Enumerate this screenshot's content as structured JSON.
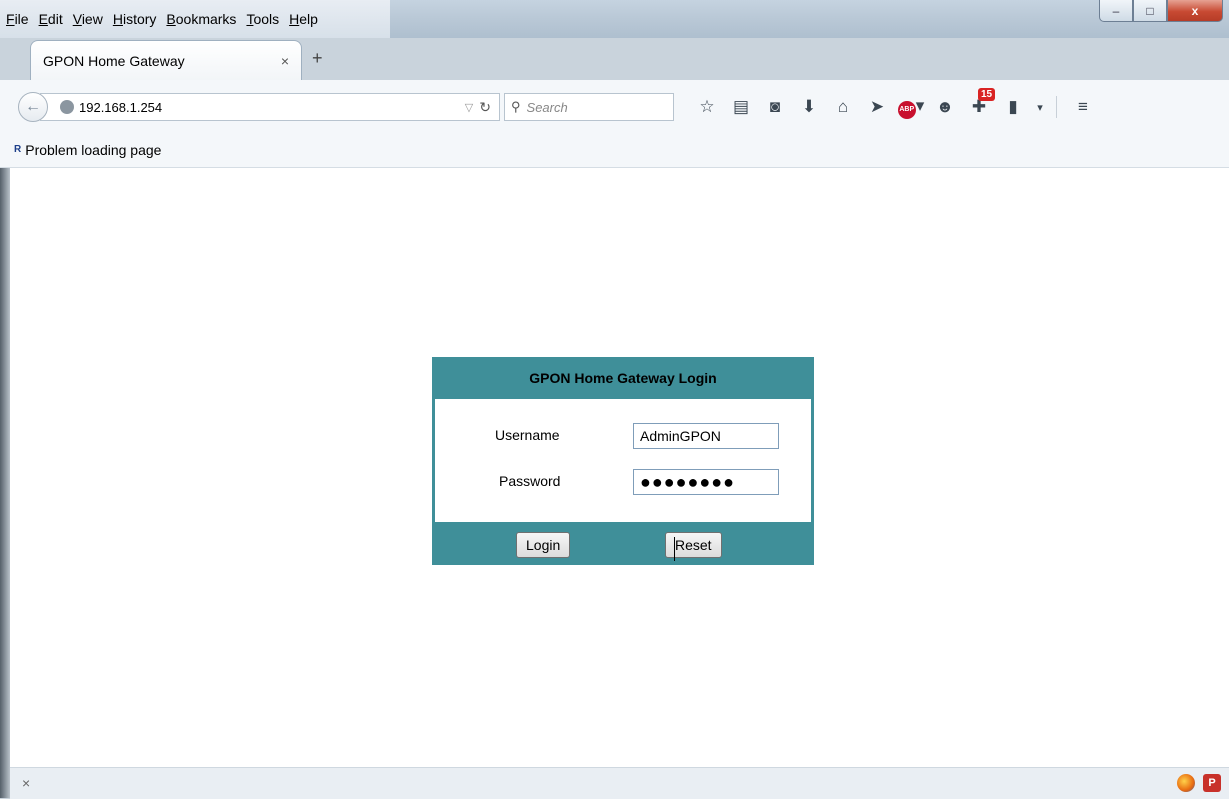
{
  "menu": {
    "items": [
      "File",
      "Edit",
      "View",
      "History",
      "Bookmarks",
      "Tools",
      "Help"
    ]
  },
  "window_buttons": {
    "minimize": "–",
    "maximize": "□",
    "close": "x"
  },
  "tab": {
    "title": "GPON Home Gateway",
    "close": "×",
    "new_tab": "+"
  },
  "navbar": {
    "url": "192.168.1.254",
    "search_placeholder": "Search",
    "downloads_badge": "15"
  },
  "bookmarks_bar": {
    "icon_text": "R",
    "label": "Problem loading page"
  },
  "login": {
    "title": "GPON Home Gateway Login",
    "username_label": "Username",
    "username_value": "AdminGPON",
    "password_label": "Password",
    "password_value": "●●●●●●●●",
    "login_button": "Login",
    "reset_button": "Reset"
  },
  "statusbar": {
    "close": "×",
    "p_icon": "P"
  },
  "colors": {
    "login_accent": "#3f8f99",
    "close_button": "#c84a33"
  }
}
